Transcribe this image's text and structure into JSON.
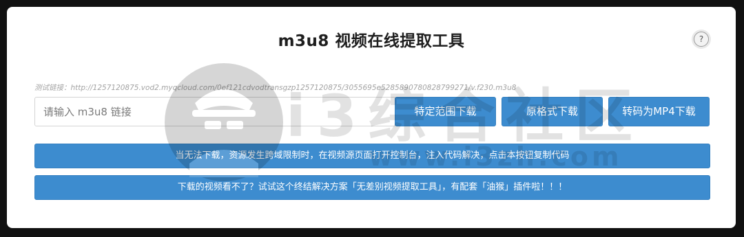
{
  "header": {
    "title": "m3u8 视频在线提取工具",
    "help_label": "?"
  },
  "test_link": {
    "text": "测试链接：http://1257120875.vod2.myqcloud.com/0ef121cdvodtransgzp1257120875/3055695e5285890780828799271/v.f230.m3u8"
  },
  "input": {
    "placeholder": "请输入 m3u8 链接",
    "value": ""
  },
  "buttons": {
    "range_download": "特定范围下载",
    "original_download": "原格式下载",
    "mp4_download": "转码为MP4下载"
  },
  "bars": {
    "cors_tip": "当无法下载，资源发生跨域限制时，在视频源页面打开控制台，注入代码解决，点击本按钮复制代码",
    "ad_tip": "下载的视频看不了？试试这个终结解决方案「无差别视频提取工具」，有配套「油猴」插件啦！！！"
  },
  "watermark": {
    "text": "i3综合社区",
    "url": "www.i3zh.com"
  },
  "colors": {
    "accent": "#3d8ccf",
    "background": "#111111",
    "panel": "#ffffff"
  }
}
